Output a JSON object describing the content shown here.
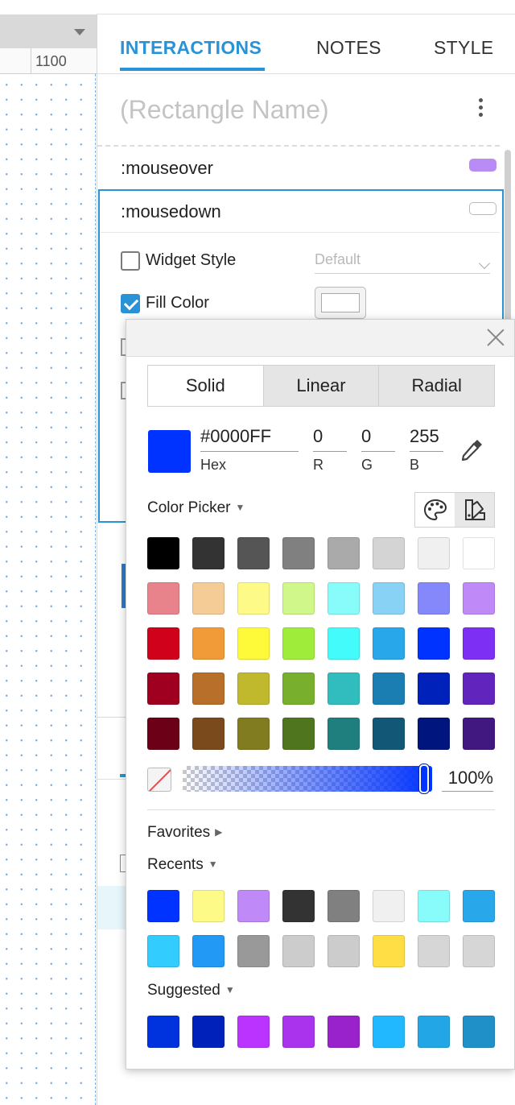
{
  "canvas": {
    "ruler_label": "1100"
  },
  "panel": {
    "tabs": [
      {
        "label": "INTERACTIONS",
        "active": true
      },
      {
        "label": "NOTES",
        "active": false
      },
      {
        "label": "STYLE",
        "active": false
      }
    ],
    "name_placeholder": "(Rectangle Name)",
    "states": [
      {
        "label": ":mouseover",
        "swatch_color": "#b98cf5"
      },
      {
        "label": ":mousedown",
        "swatch_color": "#ffffff"
      }
    ],
    "mousedown_props": [
      {
        "label": "Widget Style",
        "checked": false
      },
      {
        "label": "Fill Color",
        "checked": true
      }
    ],
    "widget_style_value": "Default",
    "accent_color": "#2a93d5"
  },
  "color_picker": {
    "tabs": [
      {
        "label": "Solid",
        "active": true
      },
      {
        "label": "Linear",
        "active": false
      },
      {
        "label": "Radial",
        "active": false
      }
    ],
    "current_color": "#0033FF",
    "hex": "#0000FF",
    "hex_label": "Hex",
    "r": "0",
    "r_label": "R",
    "g": "0",
    "g_label": "G",
    "b": "255",
    "b_label": "B",
    "picker_label": "Color Picker",
    "palette": [
      [
        "#000000",
        "#333333",
        "#555555",
        "#808080",
        "#aaaaaa",
        "#d4d4d4",
        "#f0f0f0",
        "#ffffff"
      ],
      [
        "#e8838c",
        "#f5cb96",
        "#fefa88",
        "#cff78a",
        "#88fbfb",
        "#88d3f5",
        "#8588fb",
        "#bf89f8"
      ],
      [
        "#d0021b",
        "#f09a38",
        "#fefa3a",
        "#9fed3a",
        "#44fbfb",
        "#28a8ea",
        "#0033ff",
        "#7d30f4"
      ],
      [
        "#a00020",
        "#b76f2a",
        "#c0b92e",
        "#78b02e",
        "#31bdbd",
        "#1b7eb3",
        "#0022bb",
        "#6125bd"
      ],
      [
        "#6b0016",
        "#7a4a1c",
        "#807c1f",
        "#4f751f",
        "#1f7f7f",
        "#125876",
        "#00157d",
        "#41187f"
      ]
    ],
    "opacity_fraction": 1.0,
    "opacity_text": "100%",
    "favorites_label": "Favorites",
    "recents_label": "Recents",
    "recents": [
      [
        "#0033ff",
        "#fefa88",
        "#bf89f8",
        "#333333",
        "#808080",
        "#f0f0f0",
        "#88fbfb",
        "#28a8ea"
      ],
      [
        "#33ccff",
        "#2299f5",
        "#999999",
        "#cccccc",
        "#cccccc",
        "#ffdd44",
        "#d6d6d6",
        "#d6d6d6"
      ]
    ],
    "suggested_label": "Suggested",
    "suggested": [
      "#0033dd",
      "#0022bb",
      "#bb33ff",
      "#aa33ee",
      "#9922cc",
      "#22b8ff",
      "#22a6e6",
      "#2090c8"
    ]
  }
}
